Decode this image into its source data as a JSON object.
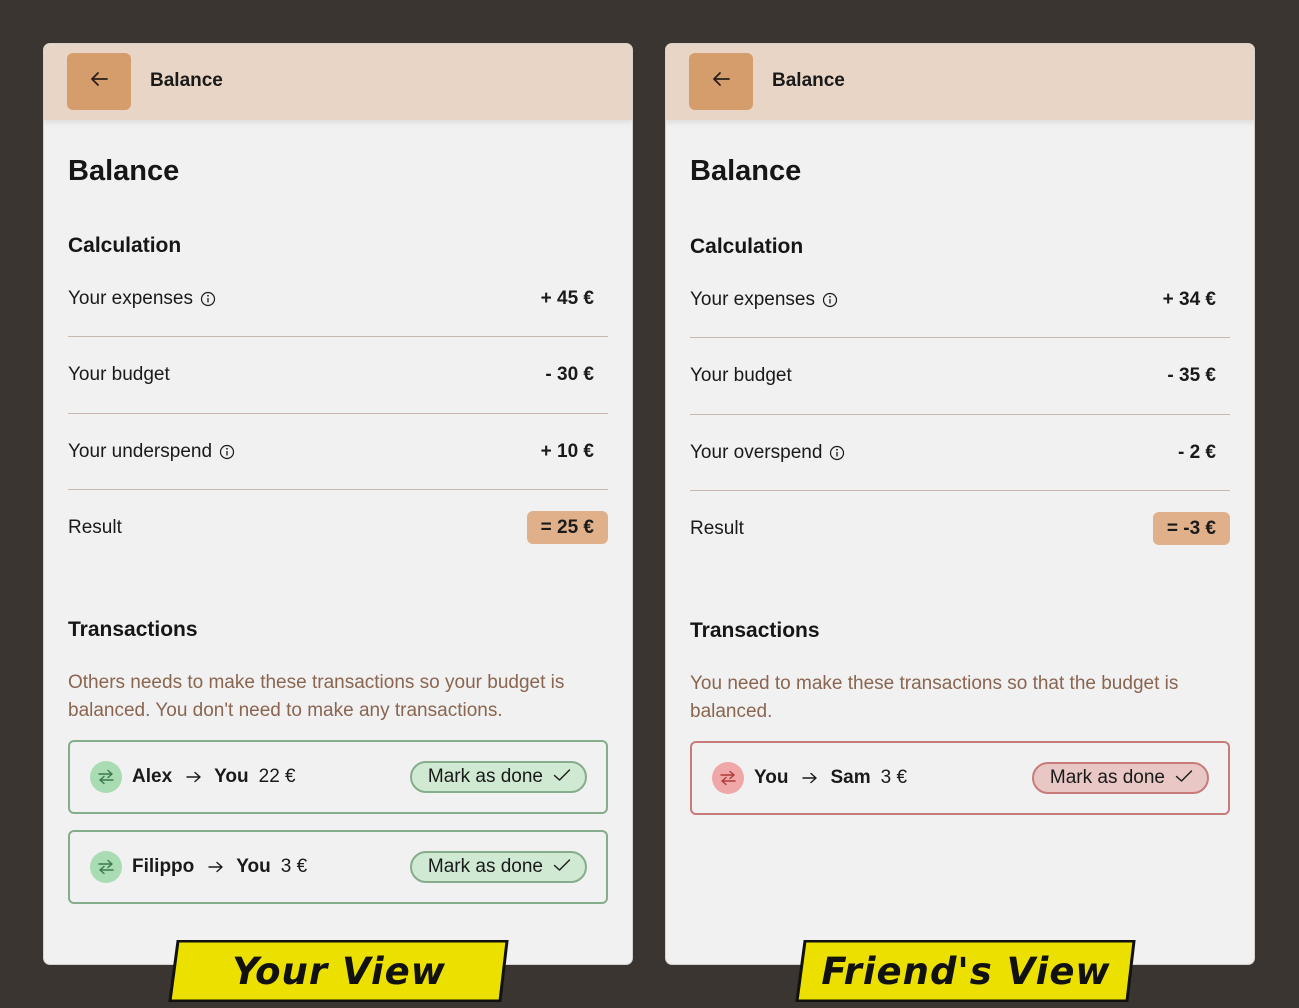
{
  "colors": {
    "background": "#3a3530",
    "card": "#f1f1f1",
    "topbar": "#e8d5c5",
    "back_button": "#d69d6c",
    "result_badge": "#e0b08a",
    "description_text": "#8a6550",
    "incoming_border": "#86ad8b",
    "incoming_fill": "#cfe9d2",
    "outgoing_border": "#c77c79",
    "outgoing_fill": "#e8c7c5",
    "banner": "#ebe000"
  },
  "icons": {
    "back": "arrow-left-icon",
    "info": "info-circle-icon",
    "transfer": "swap-arrows-icon",
    "flow": "arrow-right-icon",
    "done": "checkmark-icon"
  },
  "your_view": {
    "topbar_title": "Balance",
    "page_title": "Balance",
    "calculation_title": "Calculation",
    "rows": [
      {
        "label": "Your expenses",
        "value": "+ 45 €"
      },
      {
        "label": "Your budget",
        "value": "- 30 €"
      },
      {
        "label": "Your underspend",
        "value": "+ 10 €"
      }
    ],
    "result": {
      "label": "Result",
      "value": "= 25 €"
    },
    "transactions_title": "Transactions",
    "transactions_description": "Others needs to make these transactions so your budget is balanced. You don't need to make any transactions.",
    "transactions": [
      {
        "from": "Alex",
        "to": "You",
        "amount": "22 €",
        "action": "Mark as done"
      },
      {
        "from": "Filippo",
        "to": "You",
        "amount": "3 €",
        "action": "Mark as done"
      }
    ],
    "banner": "Your View"
  },
  "friend_view": {
    "topbar_title": "Balance",
    "page_title": "Balance",
    "calculation_title": "Calculation",
    "rows": [
      {
        "label": "Your expenses",
        "value": "+ 34 €"
      },
      {
        "label": "Your budget",
        "value": "- 35 €"
      },
      {
        "label": "Your overspend",
        "value": "- 2 €"
      }
    ],
    "result": {
      "label": "Result",
      "value": "= -3 €"
    },
    "transactions_title": "Transactions",
    "transactions_description": "You need to make these transactions so that the budget is balanced.",
    "transactions": [
      {
        "from": "You",
        "to": "Sam",
        "amount": "3 €",
        "action": "Mark as done"
      }
    ],
    "banner": "Friend's View"
  }
}
